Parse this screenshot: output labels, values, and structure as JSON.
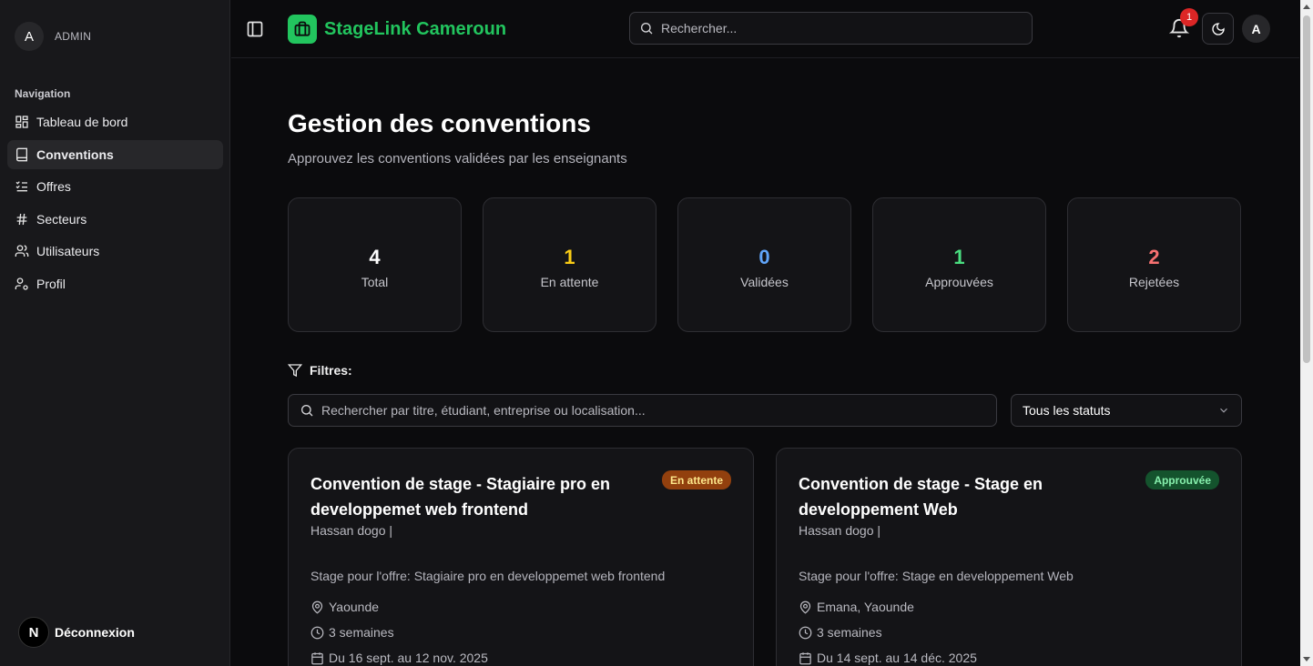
{
  "sidebar": {
    "avatar_letter": "A",
    "role": "ADMIN",
    "nav_title": "Navigation",
    "items": [
      {
        "label": "Tableau de bord",
        "icon": "dashboard-icon"
      },
      {
        "label": "Conventions",
        "icon": "book-icon",
        "active": true
      },
      {
        "label": "Offres",
        "icon": "list-checks-icon"
      },
      {
        "label": "Secteurs",
        "icon": "hash-icon"
      },
      {
        "label": "Utilisateurs",
        "icon": "users-icon"
      },
      {
        "label": "Profil",
        "icon": "user-cog-icon"
      }
    ],
    "logout_badge": "N",
    "logout_label": "Déconnexion"
  },
  "header": {
    "brand": "StageLink Cameroun",
    "search_placeholder": "Rechercher...",
    "notif_count": "1",
    "avatar_letter": "A"
  },
  "main": {
    "title": "Gestion des conventions",
    "subtitle": "Approuvez les conventions validées par les enseignants",
    "stats": [
      {
        "value": "4",
        "label": "Total",
        "color": "#ffffff"
      },
      {
        "value": "1",
        "label": "En attente",
        "color": "#facc15"
      },
      {
        "value": "0",
        "label": "Validées",
        "color": "#60a5fa"
      },
      {
        "value": "1",
        "label": "Approuvées",
        "color": "#4ade80"
      },
      {
        "value": "2",
        "label": "Rejetées",
        "color": "#f87171"
      }
    ],
    "filters_label": "Filtres:",
    "filter_search_placeholder": "Rechercher par titre, étudiant, entreprise ou localisation...",
    "status_select": "Tous les statuts",
    "cards": [
      {
        "title": "Convention de stage - Stagiaire pro en developpemet web frontend",
        "status": "En attente",
        "student": "Hassan dogo |",
        "description": "Stage pour l'offre: Stagiaire pro en developpemet web frontend",
        "location": "Yaounde",
        "duration": "3 semaines",
        "dates": "Du 16 sept. au 12 nov. 2025"
      },
      {
        "title": "Convention de stage - Stage en developpement Web",
        "status": "Approuvée",
        "student": "Hassan dogo |",
        "description": "Stage pour l'offre: Stage en developpement Web",
        "location": "Emana, Yaounde",
        "duration": "3 semaines",
        "dates": "Du 14 sept. au 14 déc. 2025"
      }
    ]
  },
  "colors": {
    "accent": "#22c55e",
    "background": "#0b0b0d",
    "sidebar": "#18181b"
  }
}
